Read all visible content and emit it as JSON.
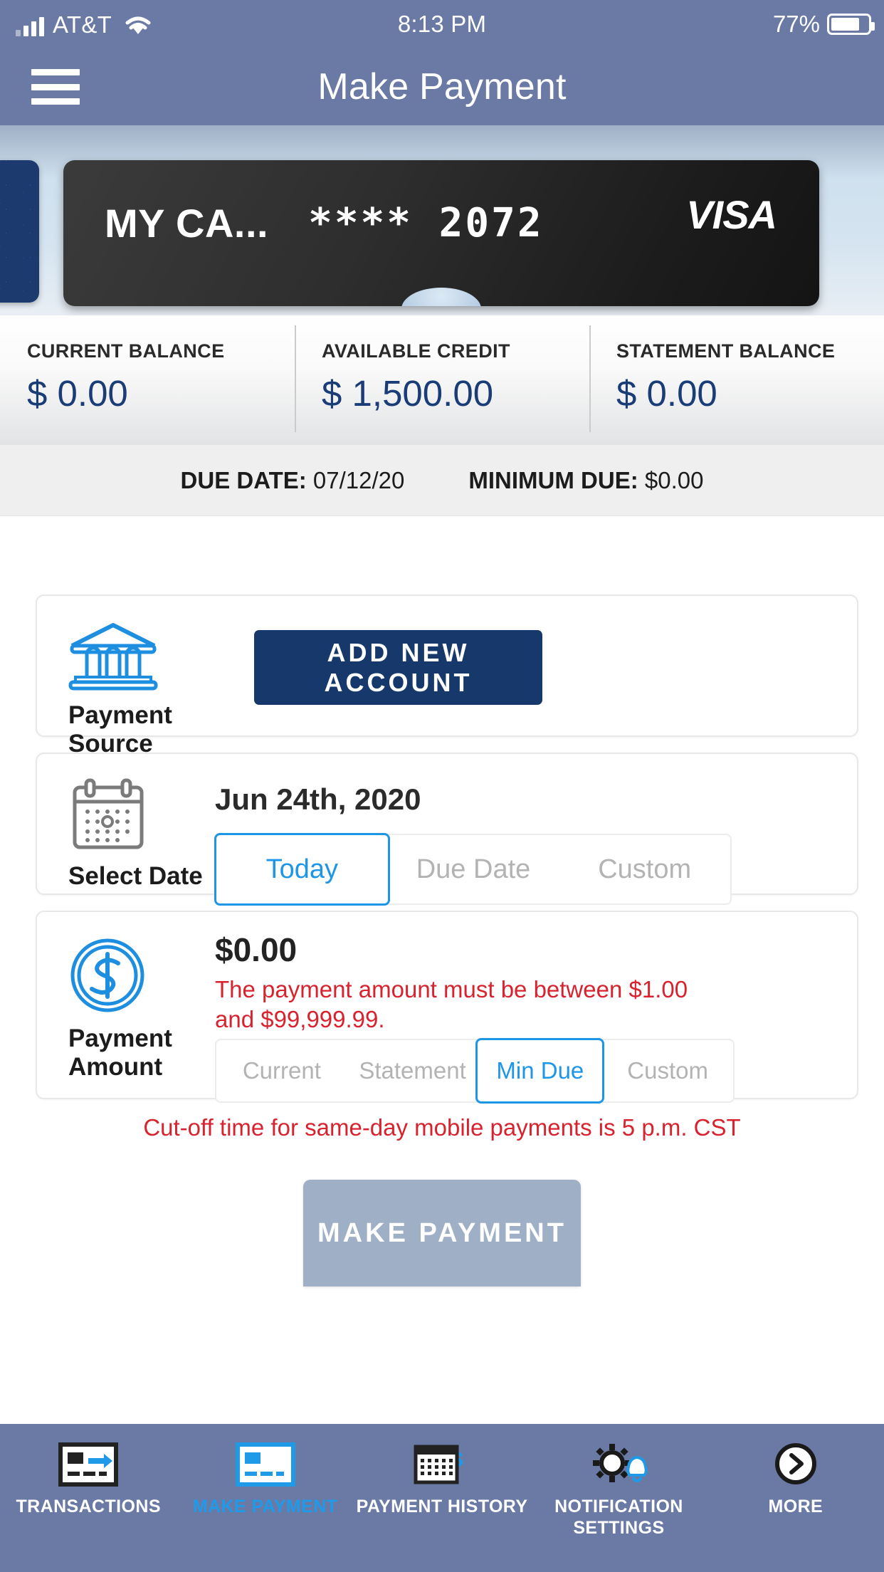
{
  "status_bar": {
    "carrier": "AT&T",
    "time": "8:13 PM",
    "battery_percent": "77%",
    "signal_icon": "signal-bars-icon",
    "wifi_icon": "wifi-icon",
    "battery_icon": "battery-icon"
  },
  "header": {
    "title": "Make Payment",
    "menu_icon": "hamburger-menu-icon",
    "background_color": "#6b7aa5"
  },
  "card": {
    "nickname": "MY CA...",
    "masked_number": "**** 2072",
    "network": "VISA",
    "peek_card_present": true
  },
  "balances": [
    {
      "label": "CURRENT BALANCE",
      "value": "$ 0.00"
    },
    {
      "label": "AVAILABLE CREDIT",
      "value": "$ 1,500.00"
    },
    {
      "label": "STATEMENT BALANCE",
      "value": "$ 0.00"
    }
  ],
  "due_strip": {
    "due_date_label": "DUE DATE:",
    "due_date_value": "07/12/20",
    "minimum_due_label": "MINIMUM DUE:",
    "minimum_due_value": "$0.00"
  },
  "payment_source": {
    "label": "Payment Source",
    "icon": "bank-icon",
    "add_account_label": "ADD NEW ACCOUNT",
    "button_color": "#17386b"
  },
  "select_date": {
    "label": "Select Date",
    "icon": "calendar-icon",
    "value": "Jun 24th, 2020",
    "options": [
      {
        "label": "Today",
        "selected": true
      },
      {
        "label": "Due Date",
        "selected": false
      },
      {
        "label": "Custom",
        "selected": false
      }
    ]
  },
  "payment_amount": {
    "label": "Payment Amount",
    "icon": "dollar-coin-icon",
    "value": "$0.00",
    "error": "The payment amount must be between $1.00 and $99,999.99.",
    "error_color": "#d8232f",
    "options": [
      {
        "label": "Current",
        "selected": false
      },
      {
        "label": "Statement",
        "selected": false
      },
      {
        "label": "Min Due",
        "selected": true
      },
      {
        "label": "Custom",
        "selected": false
      }
    ]
  },
  "cutoff_notice": "Cut-off time for same-day mobile payments is 5 p.m. CST",
  "submit": {
    "label": "MAKE PAYMENT",
    "disabled": true
  },
  "tabbar": {
    "accent_color": "#1e9ae8",
    "items": [
      {
        "label": "TRANSACTIONS",
        "icon": "card-arrow-icon",
        "active": false
      },
      {
        "label": "MAKE PAYMENT",
        "icon": "card-outline-icon",
        "active": true
      },
      {
        "label": "PAYMENT HISTORY",
        "icon": "calendar-dollar-icon",
        "active": false
      },
      {
        "label": "NOTIFICATION SETTINGS",
        "icon": "gear-bell-icon",
        "active": false
      },
      {
        "label": "MORE",
        "icon": "chevron-right-circle-icon",
        "active": false
      }
    ]
  }
}
